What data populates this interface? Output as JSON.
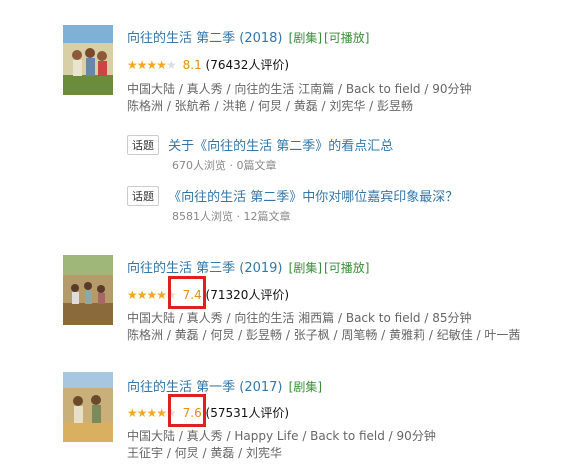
{
  "items": [
    {
      "title": "向往的生活 第二季 (2018)",
      "tags": [
        "[剧集]",
        "[可播放]"
      ],
      "stars": "★★★★",
      "stars_dim": "★",
      "score": "8.1",
      "rating_count": "(76432人评价)",
      "meta": "中国大陆 / 真人秀 / 向往的生活 江南篇 / Back to field / 90分钟",
      "cast": "陈格洲 / 张航希 / 洪艳 / 何炅 / 黄磊 / 刘宪华 / 彭昱畅"
    },
    {
      "title": "向往的生活 第三季 (2019)",
      "tags": [
        "[剧集]",
        "[可播放]"
      ],
      "stars": "★★★★",
      "stars_dim": "★",
      "score": "7.4",
      "rating_count": "(71320人评价)",
      "meta": "中国大陆 / 真人秀 / 向往的生活 湘西篇 / Back to field / 85分钟",
      "cast": "陈格洲 / 黄磊 / 何炅 / 彭昱畅 / 张子枫 / 周笔畅 / 黄雅莉 / 纪敏佳 / 叶一茜"
    },
    {
      "title": "向往的生活 第一季 (2017)",
      "tags": [
        "[剧集]"
      ],
      "stars": "★★★★",
      "stars_dim": "★",
      "score": "7.6",
      "rating_count": "(57531人评价)",
      "meta": "中国大陆 / 真人秀 / Happy Life / Back to field / 90分钟",
      "cast": "王征宇 / 何炅 / 黄磊 / 刘宪华"
    }
  ],
  "topics": [
    {
      "badge": "话题",
      "title": "关于《向往的生活 第二季》的看点汇总",
      "stats": "670人浏览 · 0篇文章"
    },
    {
      "badge": "话题",
      "title": "《向往的生活 第二季》中你对哪位嘉宾印象最深？",
      "stats": "8581人浏览 · 12篇文章"
    }
  ],
  "colors": {
    "highlight": "#e02020",
    "link": "#3377aa",
    "tag": "#3a8d3a",
    "score": "#e09015"
  }
}
